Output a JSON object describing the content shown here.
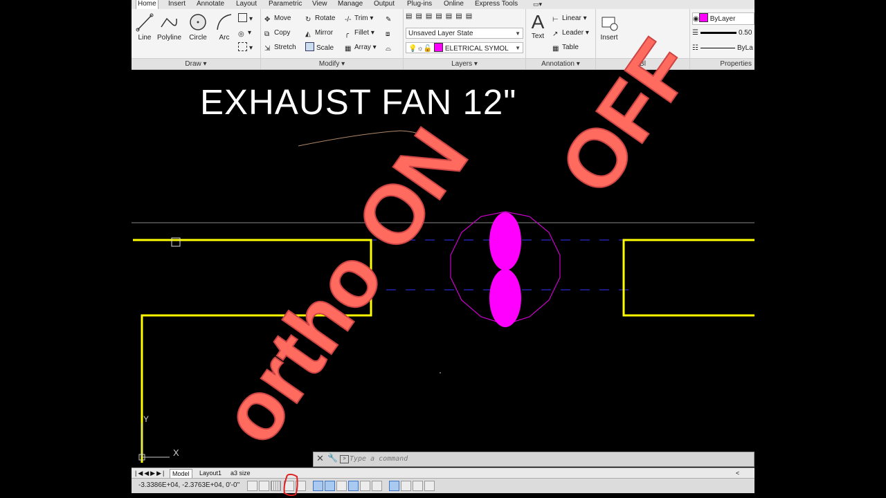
{
  "ribbon_tabs": [
    "Home",
    "Insert",
    "Annotate",
    "Layout",
    "Parametric",
    "View",
    "Manage",
    "Output",
    "Plug-ins",
    "Online",
    "Express Tools"
  ],
  "draw_panel": {
    "title": "Draw",
    "tools": [
      "Line",
      "Polyline",
      "Circle",
      "Arc"
    ]
  },
  "modify_panel": {
    "title": "Modify",
    "col1": [
      "Move",
      "Copy",
      "Stretch"
    ],
    "col2": [
      "Rotate",
      "Mirror",
      "Scale"
    ],
    "col3": [
      "Trim",
      "Fillet",
      "Array"
    ]
  },
  "layers_panel": {
    "title": "Layers",
    "layer_state": "Unsaved Layer State",
    "current_layer": "ELETRICAL SYMOL"
  },
  "annotation_panel": {
    "title": "Annotation",
    "big_tool": "Text",
    "tools": [
      "Linear",
      "Leader",
      "Table"
    ]
  },
  "block_panel": {
    "title": "Bl",
    "tool": "Insert"
  },
  "properties_panel": {
    "title": "Properties",
    "color": "ByLayer",
    "lineweight": "0.50",
    "linetype": "ByLa"
  },
  "drawing": {
    "title_text": "EXHAUST FAN 12\"",
    "stamp_line1": "ortho ON",
    "stamp_line2": "OFF",
    "ucs_y": "Y",
    "ucs_x": "X"
  },
  "command_line": {
    "placeholder": "Type a command"
  },
  "layout_tabs": [
    "Model",
    "Layout1",
    "a3 size"
  ],
  "status": {
    "coordinates": "-3.3386E+04, -2.3763E+04, 0'-0\""
  },
  "colors": {
    "stamp": "#ff6b5e",
    "wall": "#ffff00",
    "fan": "#ff00ff",
    "ortho_highlight": "#e02020"
  }
}
